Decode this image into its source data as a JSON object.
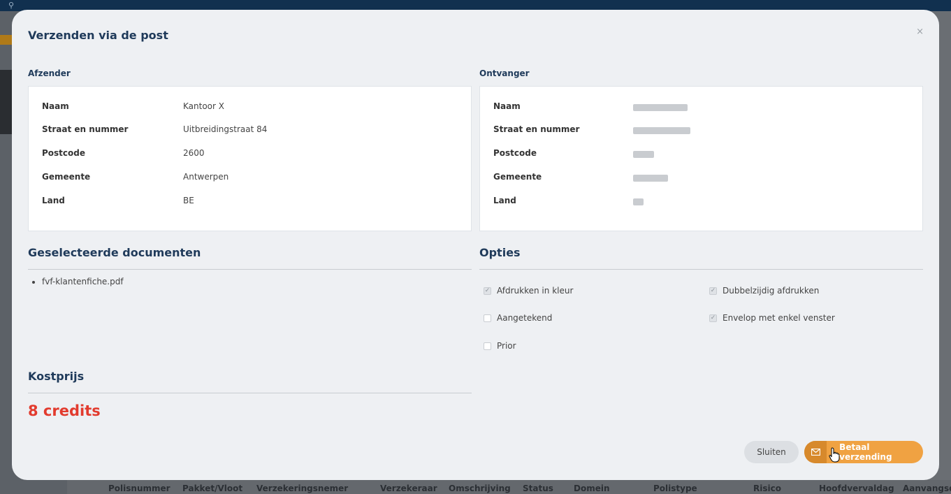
{
  "modal": {
    "title": "Verzenden via de post",
    "close_glyph": "×"
  },
  "sender": {
    "heading": "Afzender",
    "rows": [
      {
        "label": "Naam",
        "value": "Kantoor X"
      },
      {
        "label": "Straat en nummer",
        "value": "Uitbreidingstraat 84"
      },
      {
        "label": "Postcode",
        "value": "2600"
      },
      {
        "label": "Gemeente",
        "value": "Antwerpen"
      },
      {
        "label": "Land",
        "value": "BE"
      }
    ]
  },
  "recipient": {
    "heading": "Ontvanger",
    "rows": [
      {
        "label": "Naam"
      },
      {
        "label": "Straat en nummer"
      },
      {
        "label": "Postcode"
      },
      {
        "label": "Gemeente"
      },
      {
        "label": "Land"
      }
    ]
  },
  "documents": {
    "heading": "Geselecteerde documenten",
    "items": [
      "fvf-klantenfiche.pdf"
    ]
  },
  "options": {
    "heading": "Opties",
    "items": [
      {
        "label": "Afdrukken in kleur",
        "checked": true
      },
      {
        "label": "Dubbelzijdig afdrukken",
        "checked": true
      },
      {
        "label": "Aangetekend",
        "checked": false
      },
      {
        "label": "Envelop met enkel venster",
        "checked": true
      },
      {
        "label": "Prior",
        "checked": false
      }
    ]
  },
  "cost": {
    "heading": "Kostprijs",
    "value": "8 credits"
  },
  "buttons": {
    "close_label": "Sluiten",
    "pay_label": "Betaal verzending",
    "pay_icon": "mail-icon"
  },
  "background": {
    "table_columns": [
      "Polisnummer",
      "Pakket/Vloot",
      "Verzekeringsnemer",
      "Verzekeraar",
      "Omschrijving",
      "Status",
      "Domein",
      "Polistype",
      "Risico",
      "Hoofdvervaldag",
      "Aanvangsdat"
    ]
  },
  "colors": {
    "accent": "#f0a242",
    "credits": "#e23b2e",
    "heading": "#1f3a5a"
  }
}
